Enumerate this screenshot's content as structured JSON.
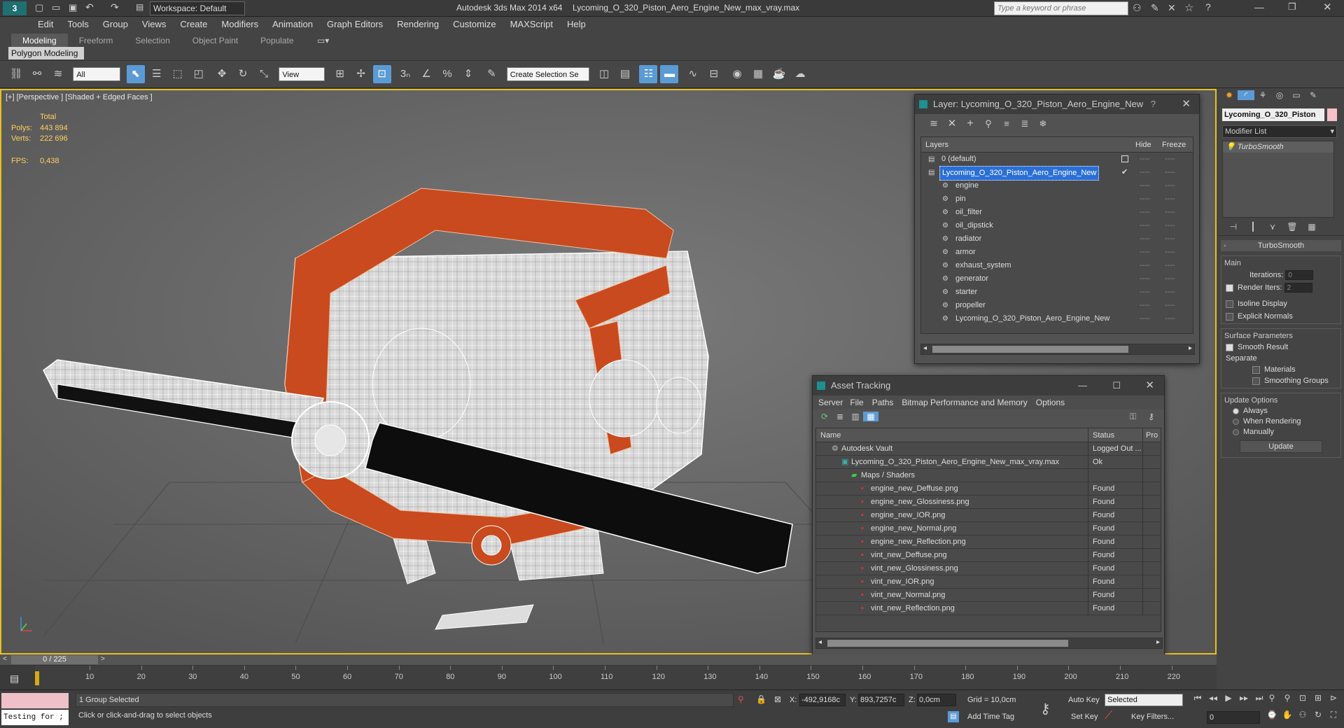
{
  "titlebar": {
    "app_title": "Autodesk 3ds Max  2014 x64",
    "file_title": "Lycoming_O_320_Piston_Aero_Engine_New_max_vray.max",
    "workspace": "Workspace: Default",
    "search_placeholder": "Type a keyword or phrase"
  },
  "menu": [
    "Edit",
    "Tools",
    "Group",
    "Views",
    "Create",
    "Modifiers",
    "Animation",
    "Graph Editors",
    "Rendering",
    "Customize",
    "MAXScript",
    "Help"
  ],
  "ribbon": {
    "tabs": [
      "Modeling",
      "Freeform",
      "Selection",
      "Object Paint",
      "Populate"
    ],
    "active_tab": "Modeling",
    "panel_label": "Polygon Modeling"
  },
  "toolbar": {
    "filter_value": "All",
    "refcoord_value": "View",
    "selection_set_value": "Create Selection Se"
  },
  "viewport": {
    "label": "[+] [Perspective ] [Shaded + Edged Faces ]",
    "stats_total": "Total",
    "polys_label": "Polys:",
    "polys_value": "443 894",
    "verts_label": "Verts:",
    "verts_value": "222 696",
    "fps_label": "FPS:",
    "fps_value": "0,438"
  },
  "layer_dialog": {
    "title": "Layer: Lycoming_O_320_Piston_Aero_Engine_New",
    "help": "?",
    "col_layers": "Layers",
    "col_hide": "Hide",
    "col_freeze": "Freeze",
    "rows": [
      {
        "name": "0 (default)",
        "level": 0,
        "selected": false
      },
      {
        "name": "Lycoming_O_320_Piston_Aero_Engine_New",
        "level": 0,
        "selected": true
      },
      {
        "name": "engine",
        "level": 1,
        "selected": false
      },
      {
        "name": "pin",
        "level": 1,
        "selected": false
      },
      {
        "name": "oil_filter",
        "level": 1,
        "selected": false
      },
      {
        "name": "oil_dipstick",
        "level": 1,
        "selected": false
      },
      {
        "name": "radiator",
        "level": 1,
        "selected": false
      },
      {
        "name": "armor",
        "level": 1,
        "selected": false
      },
      {
        "name": "exhaust_system",
        "level": 1,
        "selected": false
      },
      {
        "name": "generator",
        "level": 1,
        "selected": false
      },
      {
        "name": "starter",
        "level": 1,
        "selected": false
      },
      {
        "name": "propeller",
        "level": 1,
        "selected": false
      },
      {
        "name": "Lycoming_O_320_Piston_Aero_Engine_New",
        "level": 1,
        "selected": false
      }
    ]
  },
  "asset_dialog": {
    "title": "Asset Tracking",
    "menus": [
      "Server",
      "File",
      "Paths",
      "Bitmap Performance and Memory",
      "Options"
    ],
    "col_name": "Name",
    "col_status": "Status",
    "col_pro": "Pro",
    "rows": [
      {
        "name": "Autodesk Vault",
        "status": "Logged Out ...",
        "indent": 1,
        "icon": "vault"
      },
      {
        "name": "Lycoming_O_320_Piston_Aero_Engine_New_max_vray.max",
        "status": "Ok",
        "indent": 2,
        "icon": "max"
      },
      {
        "name": "Maps / Shaders",
        "status": "",
        "indent": 3,
        "icon": "maps"
      },
      {
        "name": "engine_new_Deffuse.png",
        "status": "Found",
        "indent": 4,
        "icon": "png"
      },
      {
        "name": "engine_new_Glossiness.png",
        "status": "Found",
        "indent": 4,
        "icon": "png"
      },
      {
        "name": "engine_new_IOR.png",
        "status": "Found",
        "indent": 4,
        "icon": "png"
      },
      {
        "name": "engine_new_Normal.png",
        "status": "Found",
        "indent": 4,
        "icon": "png"
      },
      {
        "name": "engine_new_Reflection.png",
        "status": "Found",
        "indent": 4,
        "icon": "png"
      },
      {
        "name": "vint_new_Deffuse.png",
        "status": "Found",
        "indent": 4,
        "icon": "png"
      },
      {
        "name": "vint_new_Glossiness.png",
        "status": "Found",
        "indent": 4,
        "icon": "png"
      },
      {
        "name": "vint_new_IOR.png",
        "status": "Found",
        "indent": 4,
        "icon": "png"
      },
      {
        "name": "vint_new_Normal.png",
        "status": "Found",
        "indent": 4,
        "icon": "png"
      },
      {
        "name": "vint_new_Reflection.png",
        "status": "Found",
        "indent": 4,
        "icon": "png"
      }
    ]
  },
  "command_panel": {
    "object_name": "Lycoming_O_320_Piston",
    "modifier_list": "Modifier List",
    "stack_item": "TurboSmooth",
    "rollout_title": "TurboSmooth",
    "main_group": "Main",
    "iterations_label": "Iterations:",
    "iterations_value": "0",
    "render_iters_label": "Render Iters:",
    "render_iters_value": "2",
    "isoline_label": "Isoline Display",
    "explicit_normals_label": "Explicit Normals",
    "surface_group": "Surface Parameters",
    "smooth_result_label": "Smooth Result",
    "separate_label": "Separate",
    "materials_label": "Materials",
    "smoothing_groups_label": "Smoothing Groups",
    "update_group": "Update Options",
    "always_label": "Always",
    "when_rendering_label": "When Rendering",
    "manually_label": "Manually",
    "update_button": "Update"
  },
  "timeline": {
    "frame_counter": "0 / 225",
    "ticks": [
      "10",
      "20",
      "30",
      "40",
      "50",
      "60",
      "70",
      "80",
      "90",
      "100",
      "110",
      "120",
      "130",
      "140",
      "150",
      "160",
      "170",
      "180",
      "190",
      "200",
      "210",
      "220"
    ]
  },
  "status": {
    "maxscript_text": "Testing for ;",
    "selected_text": "1 Group Selected",
    "prompt_text": "Click or click-and-drag to select objects",
    "x_label": "X:",
    "x_value": "-492,9168c",
    "y_label": "Y:",
    "y_value": "893,7257c",
    "z_label": "Z:",
    "z_value": "0,0cm",
    "grid_text": "Grid = 10,0cm",
    "add_time_tag": "Add Time Tag",
    "auto_key": "Auto Key",
    "set_key": "Set Key",
    "selected_dropdown": "Selected",
    "key_filters": "Key Filters...",
    "frame_value": "0"
  },
  "colors": {
    "accent_blue": "#5b9bd5",
    "selection_blue": "#2b6fd6",
    "viewport_border": "#e8c020",
    "armor_orange": "#c84a1e"
  }
}
